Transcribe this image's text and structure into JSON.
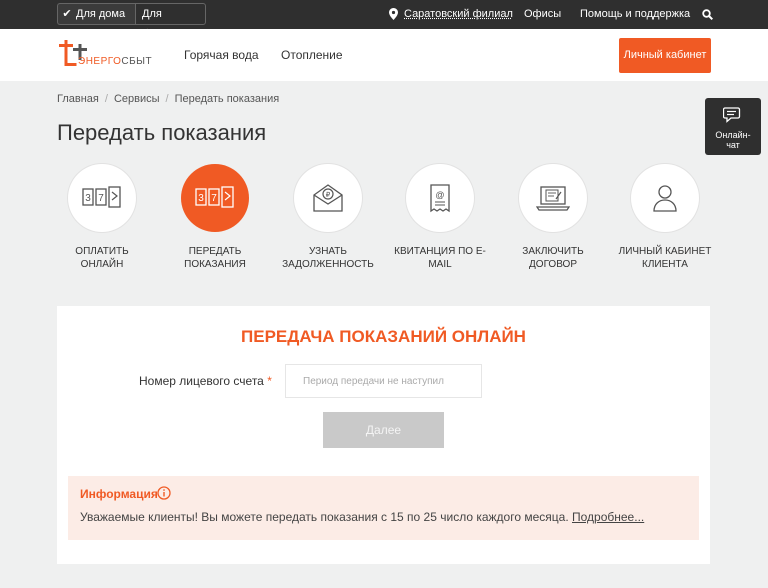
{
  "topbar": {
    "home_label": "Для дома",
    "business_label": "Для бизнеса",
    "city": "Саратовский филиал",
    "offices": "Офисы",
    "help": "Помощь и поддержка"
  },
  "header": {
    "logo_part1": "ЭНЕРГО",
    "logo_part2": "СБЫТ",
    "nav": [
      "Горячая вода",
      "Отопление"
    ],
    "cabinet_button": "Личный кабинет"
  },
  "breadcrumb": [
    "Главная",
    "Сервисы",
    "Передать показания"
  ],
  "chat": {
    "line1": "Онлайн-",
    "line2": "чат"
  },
  "page_title": "Передать показания",
  "services": [
    {
      "line1": "ОПЛАТИТЬ",
      "line2": "ОНЛАЙН",
      "icon": "meter-icon"
    },
    {
      "line1": "ПЕРЕДАТЬ",
      "line2": "ПОКАЗАНИЯ",
      "icon": "meter-icon"
    },
    {
      "line1": "УЗНАТЬ",
      "line2": "ЗАДОЛЖЕННОСТЬ",
      "icon": "envelope-ruble-icon"
    },
    {
      "line1": "КВИТАНЦИЯ ПО E-",
      "line2": "MAIL",
      "icon": "receipt-email-icon"
    },
    {
      "line1": "ЗАКЛЮЧИТЬ",
      "line2": "ДОГОВОР",
      "icon": "laptop-contract-icon"
    },
    {
      "line1": "ЛИЧНЫЙ КАБИНЕТ",
      "line2": "КЛИЕНТА",
      "icon": "user-icon"
    }
  ],
  "form": {
    "title": "ПЕРЕДАЧА ПОКАЗАНИЙ ОНЛАЙН",
    "account_label": "Номер лицевого счета",
    "required_mark": "*",
    "account_placeholder": "Период передачи не наступил",
    "account_value": "",
    "next_button": "Далее"
  },
  "info": {
    "title": "Информация",
    "text": "Уважаемые клиенты! Вы можете передать показания с 15 по 25 число каждого месяца. ",
    "more_link": "Подробнее..."
  },
  "colors": {
    "accent": "#f05a24",
    "dark": "#2f2f2f",
    "background": "#eff0f0"
  }
}
